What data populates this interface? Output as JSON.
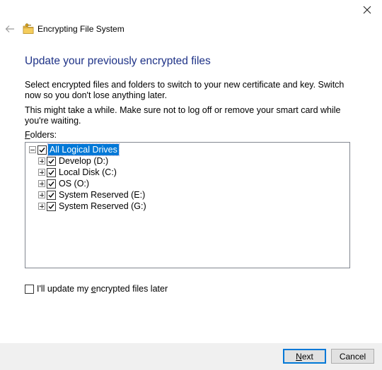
{
  "window": {
    "title": "Encrypting File System"
  },
  "page": {
    "heading": "Update your previously encrypted files",
    "paragraph1": "Select encrypted files and folders to switch to your new certificate and key. Switch now so you don't lose anything later.",
    "paragraph2": "This might take a while. Make sure not to log off or remove your smart card while you're waiting.",
    "folders_label_accel": "F",
    "folders_label_rest": "olders:"
  },
  "tree": {
    "root": {
      "label": "All Logical Drives",
      "checked": true,
      "expanded": true,
      "selected": true
    },
    "children": [
      {
        "label": "Develop (D:)",
        "checked": true,
        "expanded": false
      },
      {
        "label": "Local Disk (C:)",
        "checked": true,
        "expanded": false
      },
      {
        "label": "OS (O:)",
        "checked": true,
        "expanded": false
      },
      {
        "label": "System Reserved (E:)",
        "checked": true,
        "expanded": false
      },
      {
        "label": "System Reserved (G:)",
        "checked": true,
        "expanded": false
      }
    ]
  },
  "update_later": {
    "label_before": "I'll update my ",
    "label_accel": "e",
    "label_after": "ncrypted files later",
    "checked": false
  },
  "buttons": {
    "next_accel": "N",
    "next_rest": "ext",
    "cancel": "Cancel"
  },
  "icons": {
    "close": "close-icon",
    "back": "back-arrow-icon",
    "app": "efs-key-icon"
  },
  "colors": {
    "heading": "#1e3287",
    "selection": "#0078d7",
    "footer": "#f0f0f0"
  }
}
